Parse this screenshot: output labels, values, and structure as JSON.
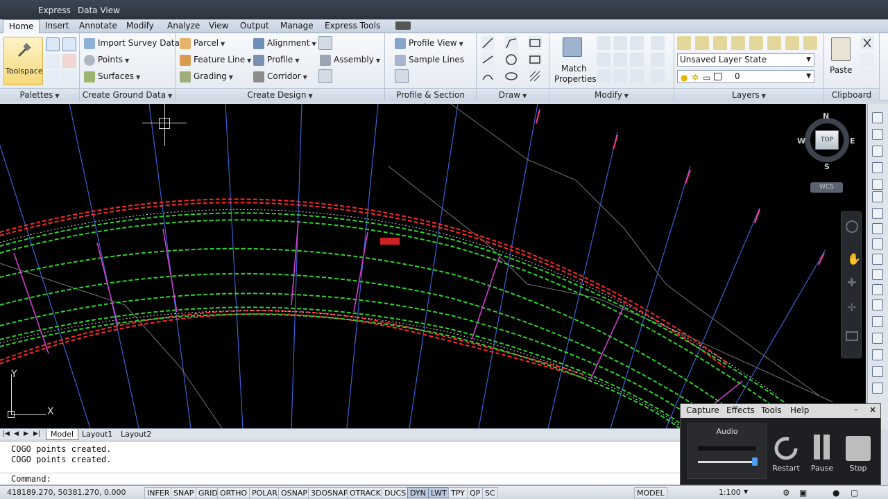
{
  "titlebar": {
    "express": "Express",
    "data_view": "Data View"
  },
  "tabs": [
    "Home",
    "Insert",
    "Annotate",
    "Modify",
    "Analyze",
    "View",
    "Output",
    "Manage",
    "Express Tools"
  ],
  "ribbon": {
    "toolspace": "Toolspace",
    "import_survey": "Import Survey Data",
    "points": "Points",
    "surfaces": "Surfaces",
    "parcel": "Parcel",
    "feature_line": "Feature Line",
    "grading": "Grading",
    "alignment": "Alignment",
    "profile": "Profile",
    "corridor": "Corridor",
    "assembly": "Assembly",
    "profile_view": "Profile View",
    "sample_lines": "Sample Lines",
    "match_properties_1": "Match",
    "match_properties_2": "Properties",
    "layer_state": "Unsaved Layer State",
    "layer_value": "0",
    "paste": "Paste",
    "panels": {
      "palettes": "Palettes",
      "create_ground": "Create Ground Data",
      "create_design": "Create Design",
      "profile_section": "Profile & Section Views",
      "draw": "Draw",
      "modify": "Modify",
      "layers": "Layers",
      "clipboard": "Clipboard"
    }
  },
  "viewcube": {
    "n": "N",
    "s": "S",
    "e": "E",
    "w": "W",
    "top": "TOP",
    "wcs": "WCS"
  },
  "ucs": {
    "y": "Y",
    "x": "X"
  },
  "layout_tabs": [
    "Model",
    "Layout1",
    "Layout2"
  ],
  "command": {
    "history": [
      "COGO points created.",
      "COGO points created."
    ],
    "prompt": "Command:"
  },
  "status": {
    "coords": "418189.270, 50381.270, 0.000",
    "toggles": [
      "INFER",
      "SNAP",
      "GRID",
      "ORTHO",
      "POLAR",
      "OSNAP",
      "3DOSNAP",
      "OTRACK",
      "DUCS",
      "DYN",
      "LWT",
      "TPY",
      "QP",
      "SC"
    ],
    "active_toggles": [
      "DYN",
      "LWT"
    ],
    "model": "MODEL",
    "scale": "1:100"
  },
  "capture": {
    "menu": [
      "Capture",
      "Effects",
      "Tools",
      "Help"
    ],
    "audio": "Audio",
    "restart": "Restart",
    "pause": "Pause",
    "stop": "Stop"
  }
}
